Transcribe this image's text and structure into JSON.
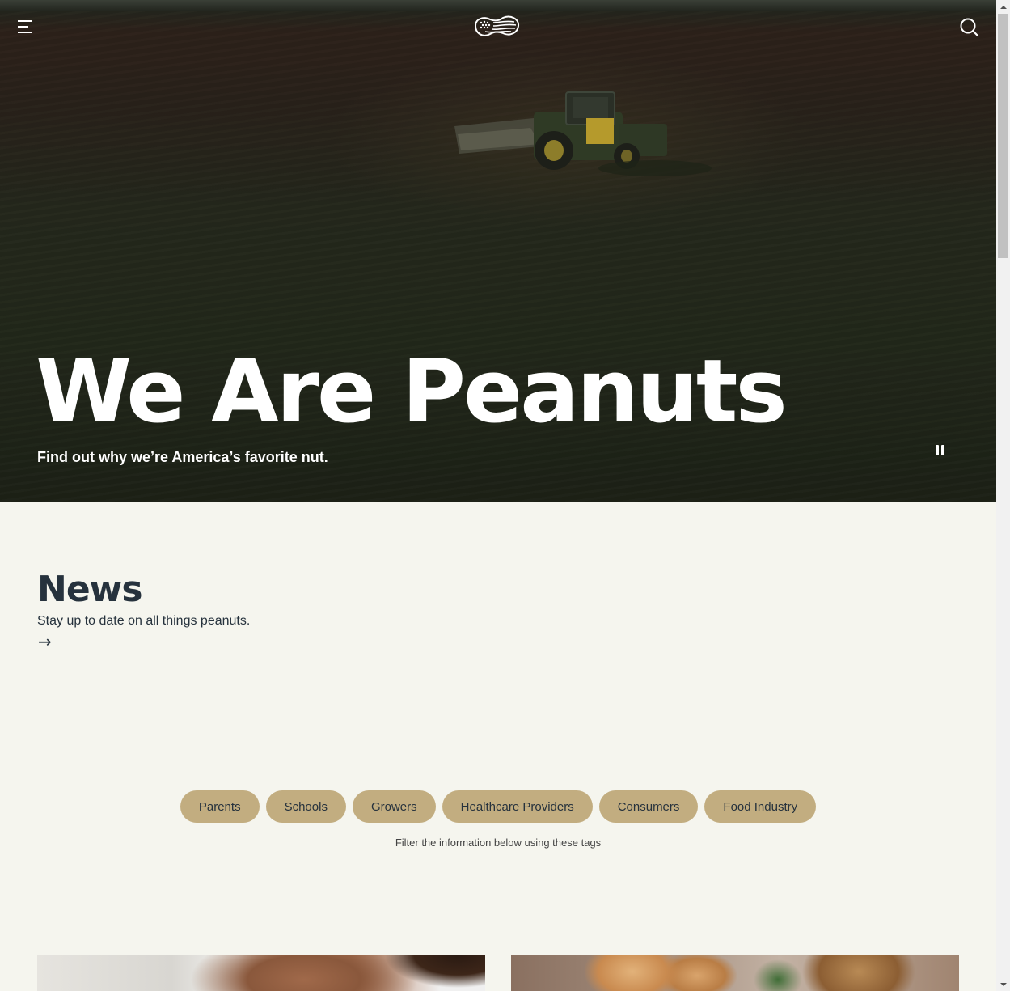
{
  "header": {
    "menu_icon": "hamburger-menu-icon",
    "logo_icon": "peanut-flag-logo",
    "search_icon": "search-icon"
  },
  "hero": {
    "title": "We Are Peanuts",
    "subtitle": "Find out why we’re America’s favorite nut.",
    "pause_icon": "pause-icon"
  },
  "news": {
    "title": "News",
    "subtitle": "Stay up to date on all things peanuts.",
    "arrow": "→"
  },
  "tags": {
    "items": [
      {
        "label": "Parents"
      },
      {
        "label": "Schools"
      },
      {
        "label": "Growers"
      },
      {
        "label": "Healthcare Providers"
      },
      {
        "label": "Consumers"
      },
      {
        "label": "Food Industry"
      }
    ],
    "hint": "Filter the information below using these tags"
  },
  "colors": {
    "page_background": "#f5f5ee",
    "heading_text": "#26323d",
    "tag_background": "#c2ad80",
    "hero_text": "#ffffff"
  }
}
